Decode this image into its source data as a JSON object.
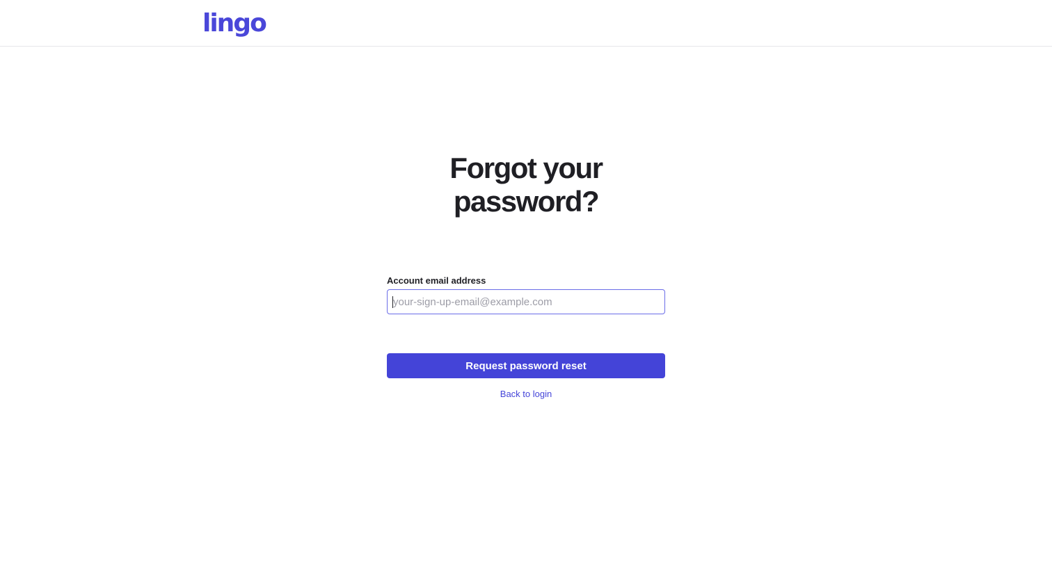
{
  "header": {
    "logo_text": "lingo"
  },
  "main": {
    "title_line1": "Forgot your",
    "title_line2": "password?",
    "email_label": "Account email address",
    "email_placeholder": "your-sign-up-email@example.com",
    "email_value": "",
    "submit_label": "Request password reset",
    "back_link_label": "Back to login"
  },
  "colors": {
    "brand": "#4a47d9",
    "button": "#4444d8",
    "text": "#1f1f24",
    "placeholder": "#9c9ca6"
  }
}
